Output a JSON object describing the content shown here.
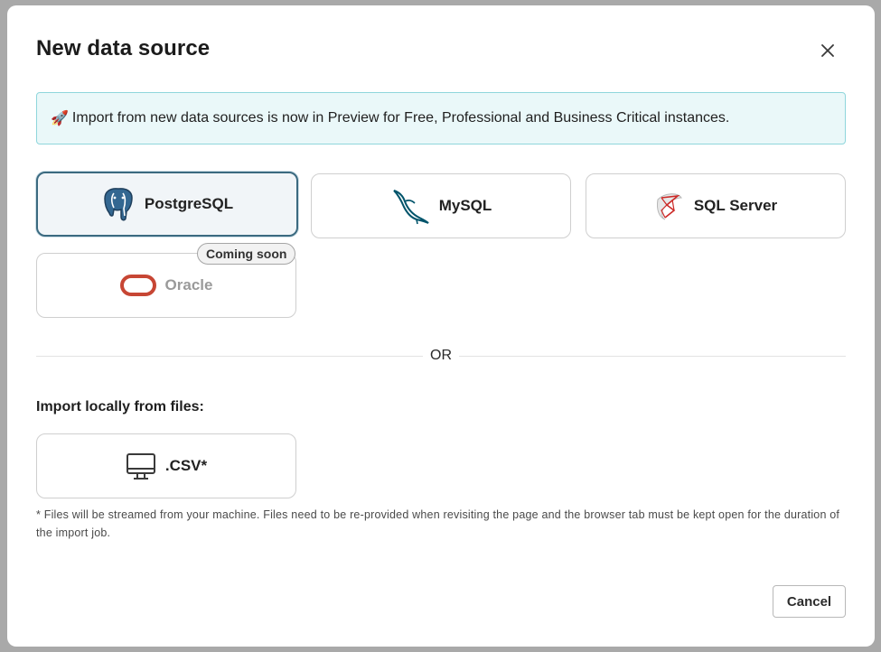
{
  "modal": {
    "title": "New data source",
    "close_icon": "close-icon"
  },
  "banner": {
    "icon": "rocket-icon",
    "emoji": "🚀",
    "text": "Import from new data sources is now in Preview for Free, Professional and Business Critical instances."
  },
  "sources": [
    {
      "label": "PostgreSQL",
      "icon": "postgresql-icon",
      "selected": true,
      "disabled": false
    },
    {
      "label": "MySQL",
      "icon": "mysql-icon",
      "selected": false,
      "disabled": false
    },
    {
      "label": "SQL Server",
      "icon": "sql-server-icon",
      "selected": false,
      "disabled": false
    },
    {
      "label": "Oracle",
      "icon": "oracle-icon",
      "selected": false,
      "disabled": true,
      "badge": "Coming soon"
    }
  ],
  "divider_text": "OR",
  "local_import": {
    "label": "Import locally from files:",
    "csv_label": ".CSV*",
    "csv_icon": "monitor-icon",
    "footnote": "* Files will be streamed from your machine. Files need to be re-provided when revisiting the page and the browser tab must be kept open for the duration of the import job."
  },
  "footer": {
    "cancel_label": "Cancel"
  },
  "colors": {
    "banner_bg": "#eaf8f9",
    "banner_border": "#8fd6dc",
    "selected_border": "#3b6a80",
    "postgres_blue": "#336791",
    "mysql_teal": "#00546b",
    "oracle_red": "#c74634",
    "sqlserver_red": "#cc2927"
  }
}
